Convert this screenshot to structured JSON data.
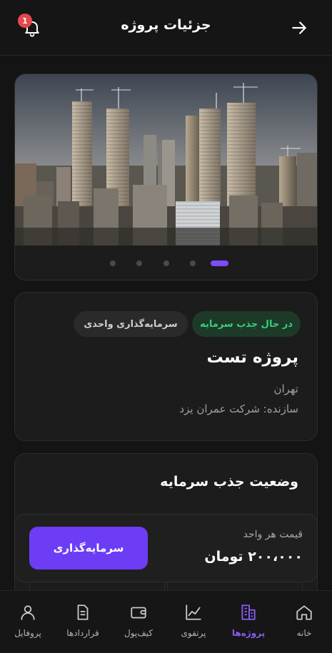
{
  "header": {
    "title": "جزئیات پروژه",
    "notification_count": "1"
  },
  "gallery": {
    "slides": 5,
    "active_index": 4
  },
  "project": {
    "status_chip": "در حال جذب سرمایه",
    "type_chip": "سرمایه‌گذاری واحدی",
    "name": "پروژه تست",
    "city": "تهران",
    "builder": "سازنده: شرکت عمران یزد"
  },
  "funding": {
    "title": "وضعیت جذب سرمایه"
  },
  "purchase": {
    "unit_price_label": "قیمت هر واحد",
    "unit_price": "۲۰۰،۰۰۰ تومان",
    "invest_label": "سرمایه‌گذاری"
  },
  "nav": {
    "items": [
      {
        "label": "خانه",
        "icon": "home-icon"
      },
      {
        "label": "پروژه‌ها",
        "icon": "buildings-icon",
        "active": true
      },
      {
        "label": "پرتفوی",
        "icon": "chart-line-icon"
      },
      {
        "label": "کیف‌پول",
        "icon": "wallet-icon"
      },
      {
        "label": "قراردادها",
        "icon": "document-icon"
      },
      {
        "label": "پروفایل",
        "icon": "user-icon"
      }
    ]
  },
  "colors": {
    "accent": "#6d3df5",
    "success": "#36d07a",
    "badge": "#e5484d",
    "background": "#141414",
    "card": "#1c1c1c"
  }
}
